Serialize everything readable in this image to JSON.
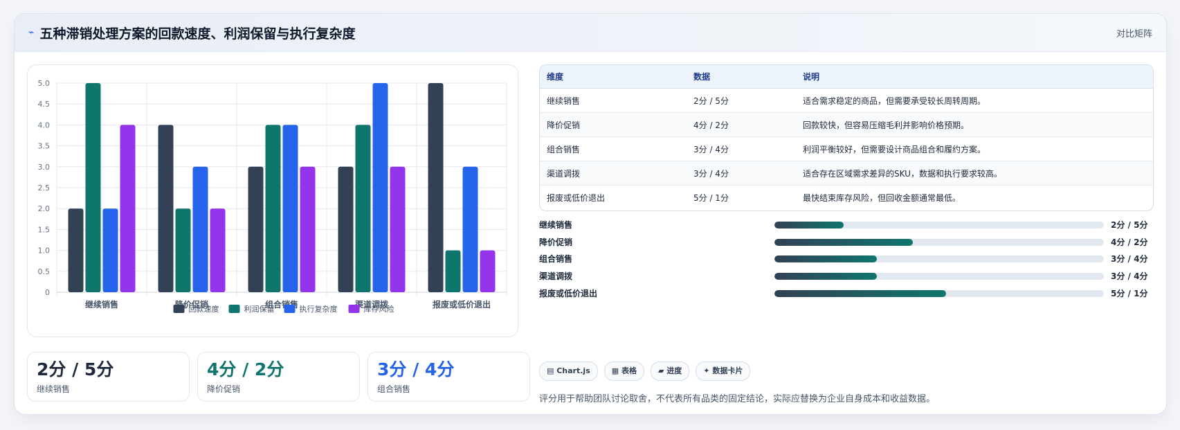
{
  "header": {
    "icon": "trend-line-icon",
    "title": "五种滞销处理方案的回款速度、利润保留与执行复杂度",
    "tag": "对比矩阵"
  },
  "chart_data": {
    "type": "bar",
    "categories": [
      "继续销售",
      "降价促销",
      "组合销售",
      "渠道调拨",
      "报废或低价退出"
    ],
    "series": [
      {
        "name": "回款速度",
        "color": "#334155",
        "values": [
          2,
          4,
          3,
          3,
          5
        ]
      },
      {
        "name": "利润保留",
        "color": "#0f766e",
        "values": [
          5,
          2,
          4,
          4,
          1
        ]
      },
      {
        "name": "执行复杂度",
        "color": "#2563eb",
        "values": [
          2,
          3,
          4,
          5,
          3
        ]
      },
      {
        "name": "库存风险",
        "color": "#9333ea",
        "values": [
          4,
          2,
          3,
          3,
          1
        ]
      }
    ],
    "ylim": [
      0,
      5
    ],
    "yticks": [
      "5.0",
      "4.5",
      "4.0",
      "3.5",
      "3.0",
      "2.5",
      "2.0",
      "1.5",
      "1.0",
      "0.5",
      "0"
    ],
    "grid": true,
    "legend": "bottom"
  },
  "stats": [
    {
      "value": "2分 / 5分",
      "label": "继续销售",
      "color": "#1e293b"
    },
    {
      "value": "4分 / 2分",
      "label": "降价促销",
      "color": "#0f766e"
    },
    {
      "value": "3分 / 4分",
      "label": "组合销售",
      "color": "#2563eb"
    }
  ],
  "table": {
    "headers": [
      "维度",
      "数据",
      "说明"
    ],
    "rows": [
      [
        "继续销售",
        "2分 / 5分",
        "适合需求稳定的商品，但需要承受较长周转周期。"
      ],
      [
        "降价促销",
        "4分 / 2分",
        "回款较快，但容易压缩毛利并影响价格预期。"
      ],
      [
        "组合销售",
        "3分 / 4分",
        "利润平衡较好，但需要设计商品组合和履约方案。"
      ],
      [
        "渠道调拨",
        "3分 / 4分",
        "适合存在区域需求差异的SKU，数据和执行要求较高。"
      ],
      [
        "报废或低价退出",
        "5分 / 1分",
        "最快结束库存风险，但回收金额通常最低。"
      ]
    ]
  },
  "progress": [
    {
      "label": "继续销售",
      "value": "2分 / 5分",
      "fraction": 0.21
    },
    {
      "label": "降价促销",
      "value": "4分 / 2分",
      "fraction": 0.42
    },
    {
      "label": "组合销售",
      "value": "3分 / 4分",
      "fraction": 0.31
    },
    {
      "label": "渠道调拨",
      "value": "3分 / 4分",
      "fraction": 0.31
    },
    {
      "label": "报废或低价退出",
      "value": "5分 / 1分",
      "fraction": 0.52
    }
  ],
  "chips": [
    {
      "icon": "chart-icon",
      "glyph": "▤",
      "label": "Chart.js"
    },
    {
      "icon": "table-icon",
      "glyph": "▦",
      "label": "表格"
    },
    {
      "icon": "progress-icon",
      "glyph": "▰",
      "label": "进度"
    },
    {
      "icon": "card-icon",
      "glyph": "✦",
      "label": "数据卡片"
    }
  ],
  "footnote": "评分用于帮助团队讨论取舍，不代表所有品类的固定结论，实际应替换为企业自身成本和收益数据。"
}
